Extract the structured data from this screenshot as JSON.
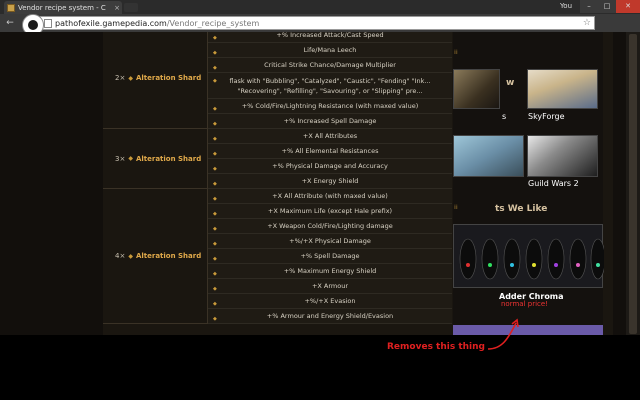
{
  "browser": {
    "tab_title": "Vendor recipe system - C",
    "tab_close": "×",
    "user_label": "You",
    "url_host": "pathofexile.gamepedia.com",
    "url_path": "/Vendor_recipe_system",
    "nav_back": "←",
    "nav_forward": "→",
    "star": "☆"
  },
  "recipes": [
    {
      "mult": "2×",
      "name": "Alteration Shard",
      "rows": [
        "+% Increased Attack/Cast Speed",
        "Life/Mana Leech",
        "Critical Strike Chance/Damage Multiplier",
        "flask with \"Bubbling\", \"Catalyzed\", \"Caustic\", \"Fending\" \"Ink... \"Recovering\", \"Refilling\", \"Savouring\", or \"Slipping\" pre...",
        "+% Cold/Fire/Lightning Resistance (with maxed value)",
        "+% Increased Spell Damage"
      ]
    },
    {
      "mult": "3×",
      "name": "Alteration Shard",
      "rows": [
        "+X All Attributes",
        "+% All Elemental Resistances",
        "+% Physical Damage and Accuracy",
        "+X Energy Shield"
      ]
    },
    {
      "mult": "4×",
      "name": "Alteration Shard",
      "rows": [
        "+X All Attribute (with maxed value)",
        "+X Maximum Life (except Hale prefix)",
        "+X Weapon Cold/Fire/Lighting damage",
        "+%/+X Physical Damage",
        "+% Spell Damage",
        "+% Maximum Energy Shield",
        "+X Armour",
        "+%/+X Evasion",
        "+% Armour and Energy Shield/Evasion"
      ]
    }
  ],
  "sidebar": {
    "head1": "w",
    "games": [
      {
        "caption": "s"
      },
      {
        "caption": "SkyForge"
      },
      {
        "caption": ""
      },
      {
        "caption": "Guild Wars 2"
      }
    ],
    "head2": "ts We Like",
    "product": "Adder Chroma",
    "product_price": "normal price!"
  },
  "annotation": {
    "text": "Removes this thing"
  }
}
